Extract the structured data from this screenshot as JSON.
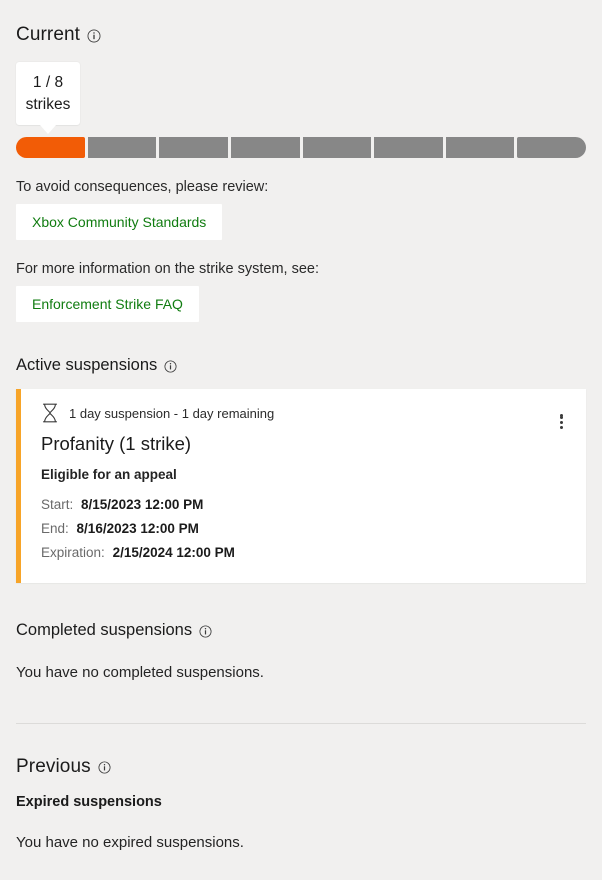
{
  "colors": {
    "page_bg": "#f1f0ef",
    "card_bg": "#ffffff",
    "strike_filled": "#f25c06",
    "strike_empty": "#878787",
    "card_accent": "#f7a428",
    "link_green": "#107c10",
    "divider": "#dcdbd9"
  },
  "current": {
    "title": "Current",
    "info_icon": "info-circle-icon",
    "callout": {
      "line1": "1 / 8",
      "line2": "strikes"
    },
    "meter": {
      "total": 8,
      "filled": 1
    },
    "review_prompt": "To avoid consequences, please review:",
    "review_link": "Xbox Community Standards",
    "faq_prompt": "For more information on the strike system, see:",
    "faq_link": "Enforcement Strike FAQ"
  },
  "active": {
    "title": "Active suspensions",
    "info_icon": "info-circle-icon",
    "card": {
      "status_icon": "hourglass-icon",
      "menu_icon": "kebab-menu-icon",
      "duration": "1 day suspension - 1 day remaining",
      "reason": "Profanity (1 strike)",
      "appeal": "Eligible for an appeal",
      "details": [
        {
          "label": "Start:",
          "value": "8/15/2023 12:00 PM"
        },
        {
          "label": "End:",
          "value": "8/16/2023 12:00 PM"
        },
        {
          "label": "Expiration:",
          "value": "2/15/2024 12:00 PM"
        }
      ]
    }
  },
  "completed": {
    "title": "Completed suspensions",
    "info_icon": "info-circle-icon",
    "empty": "You have no completed suspensions."
  },
  "previous": {
    "title": "Previous",
    "info_icon": "info-circle-icon",
    "expired_title": "Expired suspensions",
    "empty": "You have no expired suspensions."
  }
}
